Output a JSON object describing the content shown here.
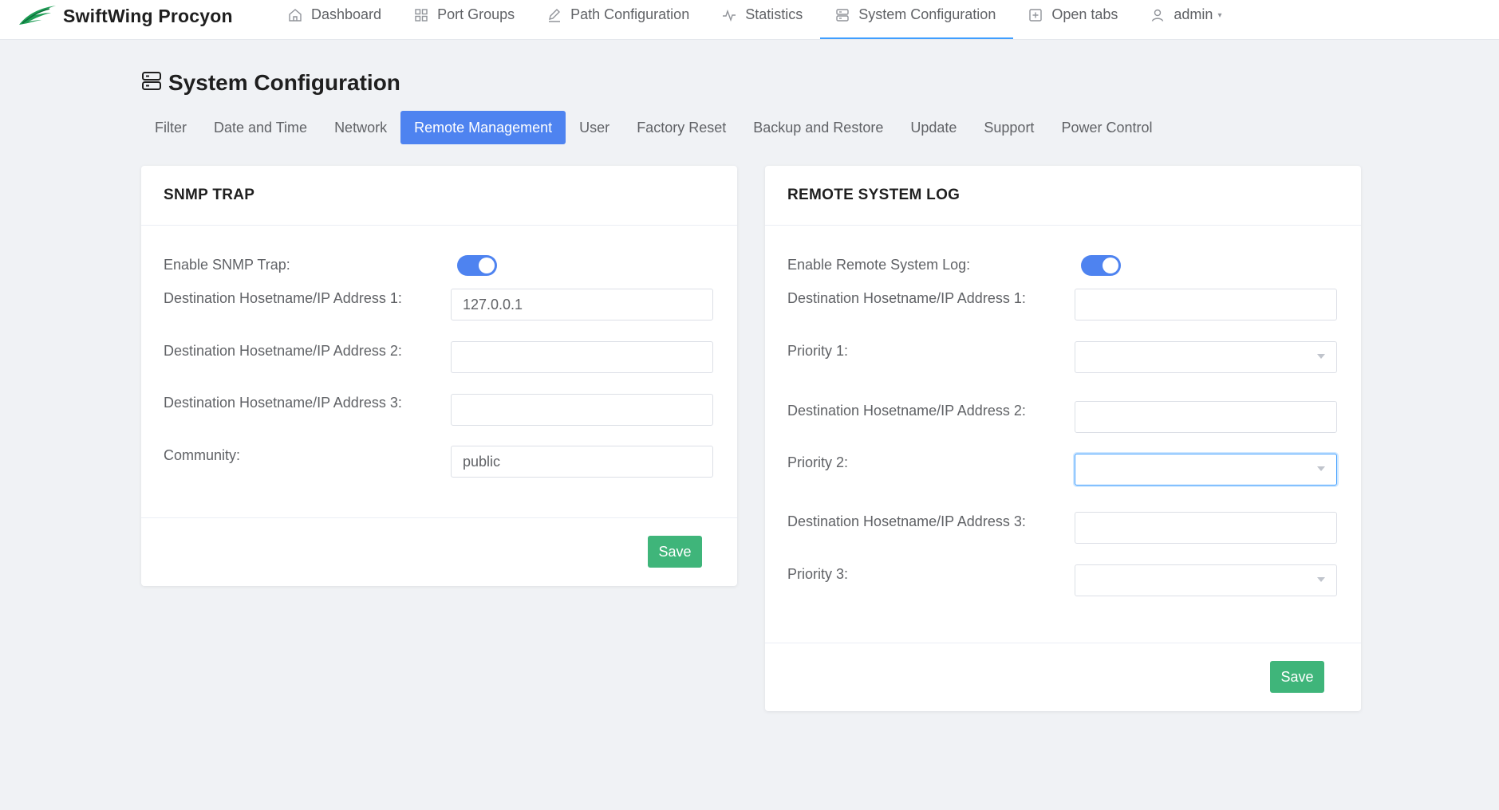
{
  "brand": {
    "name": "SwiftWing Procyon",
    "logo_icon": "wing-logo-icon",
    "logo_color": "#1f9d55"
  },
  "nav": {
    "items": [
      {
        "label": "Dashboard",
        "icon": "home-icon"
      },
      {
        "label": "Port Groups",
        "icon": "grid-icon"
      },
      {
        "label": "Path Configuration",
        "icon": "edit-icon"
      },
      {
        "label": "Statistics",
        "icon": "pulse-icon"
      },
      {
        "label": "System Configuration",
        "icon": "server-icon",
        "active": true
      },
      {
        "label": "Open tabs",
        "icon": "plus-square-icon"
      },
      {
        "label": "admin",
        "icon": "user-icon"
      }
    ]
  },
  "page": {
    "title": "System Configuration",
    "title_icon": "server-icon"
  },
  "tabs": [
    {
      "label": "Filter"
    },
    {
      "label": "Date and Time"
    },
    {
      "label": "Network"
    },
    {
      "label": "Remote Management",
      "active": true
    },
    {
      "label": "User"
    },
    {
      "label": "Factory Reset"
    },
    {
      "label": "Backup and Restore"
    },
    {
      "label": "Update"
    },
    {
      "label": "Support"
    },
    {
      "label": "Power Control"
    }
  ],
  "snmp": {
    "title": "SNMP TRAP",
    "enable_label": "Enable SNMP Trap:",
    "enabled": true,
    "dest1_label": "Destination Hosetname/IP Address 1:",
    "dest1_value": "127.0.0.1",
    "dest2_label": "Destination Hosetname/IP Address 2:",
    "dest2_value": "",
    "dest3_label": "Destination Hosetname/IP Address 3:",
    "dest3_value": "",
    "community_label": "Community:",
    "community_value": "public",
    "save_label": "Save"
  },
  "syslog": {
    "title": "REMOTE SYSTEM LOG",
    "enable_label": "Enable Remote System Log:",
    "enabled": true,
    "dest1_label": "Destination Hosetname/IP Address 1:",
    "dest1_value": "",
    "priority1_label": "Priority 1:",
    "priority1_value": "",
    "dest2_label": "Destination Hosetname/IP Address 2:",
    "dest2_value": "",
    "priority2_label": "Priority 2:",
    "priority2_value": "",
    "dest3_label": "Destination Hosetname/IP Address 3:",
    "dest3_value": "",
    "priority3_label": "Priority 3:",
    "priority3_value": "",
    "save_label": "Save"
  },
  "colors": {
    "primary": "#4e83f0",
    "save": "#3fb57a",
    "active_underline": "#409eff"
  }
}
